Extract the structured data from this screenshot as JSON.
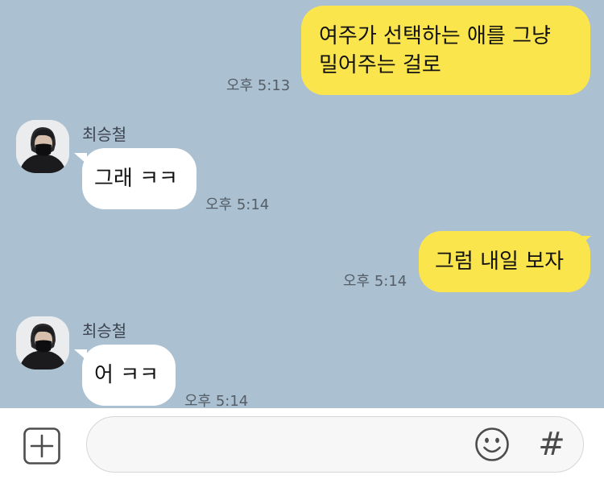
{
  "messages": [
    {
      "side": "me",
      "lines": [
        "여주가 선택하는 애를 그냥",
        "밀어주는 걸로"
      ],
      "time": "오후 5:13"
    },
    {
      "side": "them",
      "sender": "최승철",
      "text": "그래 ㅋㅋ",
      "time": "오후 5:14"
    },
    {
      "side": "me",
      "text": "그럼 내일 보자",
      "time": "오후 5:14"
    },
    {
      "side": "them",
      "sender": "최승철",
      "text": "어 ㅋㅋ",
      "time": "오후 5:14"
    }
  ],
  "input_bar": {
    "placeholder": "",
    "plus_icon": "plus-square-icon",
    "emoji_icon": "smiley-icon",
    "hash_label": "#"
  },
  "colors": {
    "background": "#abc1d1",
    "my_bubble": "#fbe54d",
    "their_bubble": "#ffffff"
  }
}
